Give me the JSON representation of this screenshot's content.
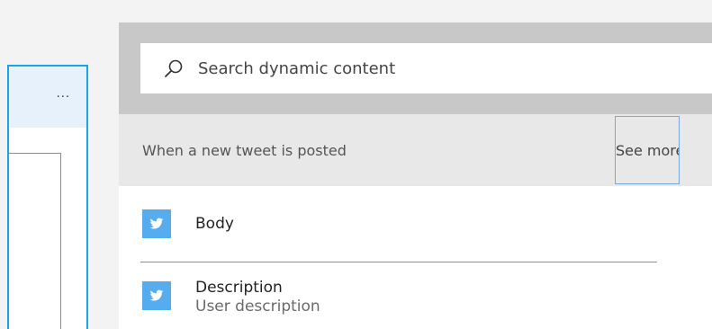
{
  "left_card": {
    "more_label": "···"
  },
  "search": {
    "placeholder": "Search dynamic content",
    "icon": "search-icon"
  },
  "section": {
    "title": "When a new tweet is posted",
    "see_more_label": "See more"
  },
  "tokens": [
    {
      "name": "Body",
      "description": "",
      "icon": "twitter-icon"
    },
    {
      "name": "Description",
      "description": "User description",
      "icon": "twitter-icon"
    }
  ],
  "colors": {
    "accent_border": "#1aa3e6",
    "twitter_blue": "#55acee",
    "search_band": "#c8c8c8",
    "section_band": "#e8e8e8",
    "see_more_border": "#7aa7e0"
  }
}
